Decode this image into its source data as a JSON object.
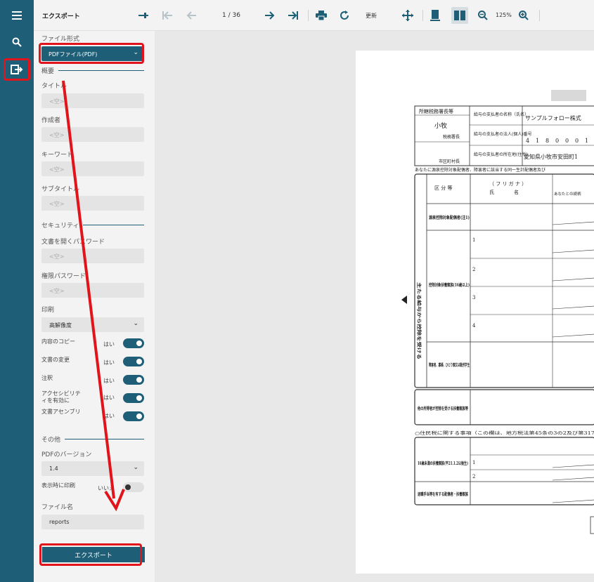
{
  "toolbar": {
    "panel_title": "エクスポート",
    "page_indicator": "1 / 36",
    "refresh_label": "更新",
    "zoom_level": "125%"
  },
  "panel": {
    "file_format_label": "ファイル形式",
    "file_format_value": "PDFファイル(PDF)",
    "summary_section": "概要",
    "title_label": "タイトル",
    "title_placeholder": "<空>",
    "author_label": "作成者",
    "author_placeholder": "<空>",
    "keywords_label": "キーワード",
    "keywords_placeholder": "<空>",
    "subtitle_label": "サブタイトル",
    "subtitle_placeholder": "<空>",
    "security_section": "セキュリティ",
    "open_password_label": "文書を開くパスワード",
    "open_password_placeholder": "<空>",
    "permission_password_label": "権限パスワード",
    "permission_password_placeholder": "<空>",
    "print_label": "印刷",
    "print_value": "高解像度",
    "toggles": [
      {
        "label": "内容のコピー",
        "value": "はい"
      },
      {
        "label": "文書の変更",
        "value": "はい"
      },
      {
        "label": "注釈",
        "value": "はい"
      },
      {
        "label": "アクセシビリティを有効に",
        "value": "はい"
      },
      {
        "label": "文書アセンブリ",
        "value": "はい"
      }
    ],
    "other_section": "その他",
    "pdf_version_label": "PDFのバージョン",
    "pdf_version_value": "1.4",
    "print_on_open_label": "表示時に印刷",
    "print_on_open_value": "いいえ",
    "filename_label": "ファイル名",
    "filename_value": "reports",
    "export_button": "エクスポート"
  },
  "document": {
    "h1": "所轄税務署長等",
    "payer_name_label": "給与の支払者の名称（氏名）",
    "payer_name": "サンプルフォロー株式",
    "office": "小牧",
    "office_suffix": "税務署長",
    "corp_no_label": "給与の支払者の法人(個人)番号",
    "corp_no": [
      "4",
      "1",
      "8",
      "0",
      "0",
      "0",
      "1"
    ],
    "addr_label": "給与の支払者の所在地(住所)",
    "address": "愛知県小牧市安田町1",
    "city_label": "市区町村長",
    "note": "あなたに源泉控除対象配偶者、障害者に該当する同一生計配偶者及び",
    "col_kubun": "区 分 等",
    "col_furigana": "（ フ リ ガ ナ ）",
    "col_shimei": "氏　　　　名",
    "col_rel": "あなたとの続柄",
    "row_a": "源泉控除対象配偶者(注1)",
    "row_b": "控除対象扶養親族(16歳以上)",
    "row_c": "障害者、寡婦、ひとり親又は勤労学生",
    "row_d": "他の所得者が控除を受ける扶養親族等",
    "side_label": "主たる給与から控除を受ける",
    "juminzei": "○住民税に関する事項（この欄は、地方税法第45条の3の2及び第317",
    "row_16": "16歳未満の扶養親族(平21.1.2以後生)",
    "row_taishoku": "退職手当等を有する配偶者・扶養親族"
  }
}
